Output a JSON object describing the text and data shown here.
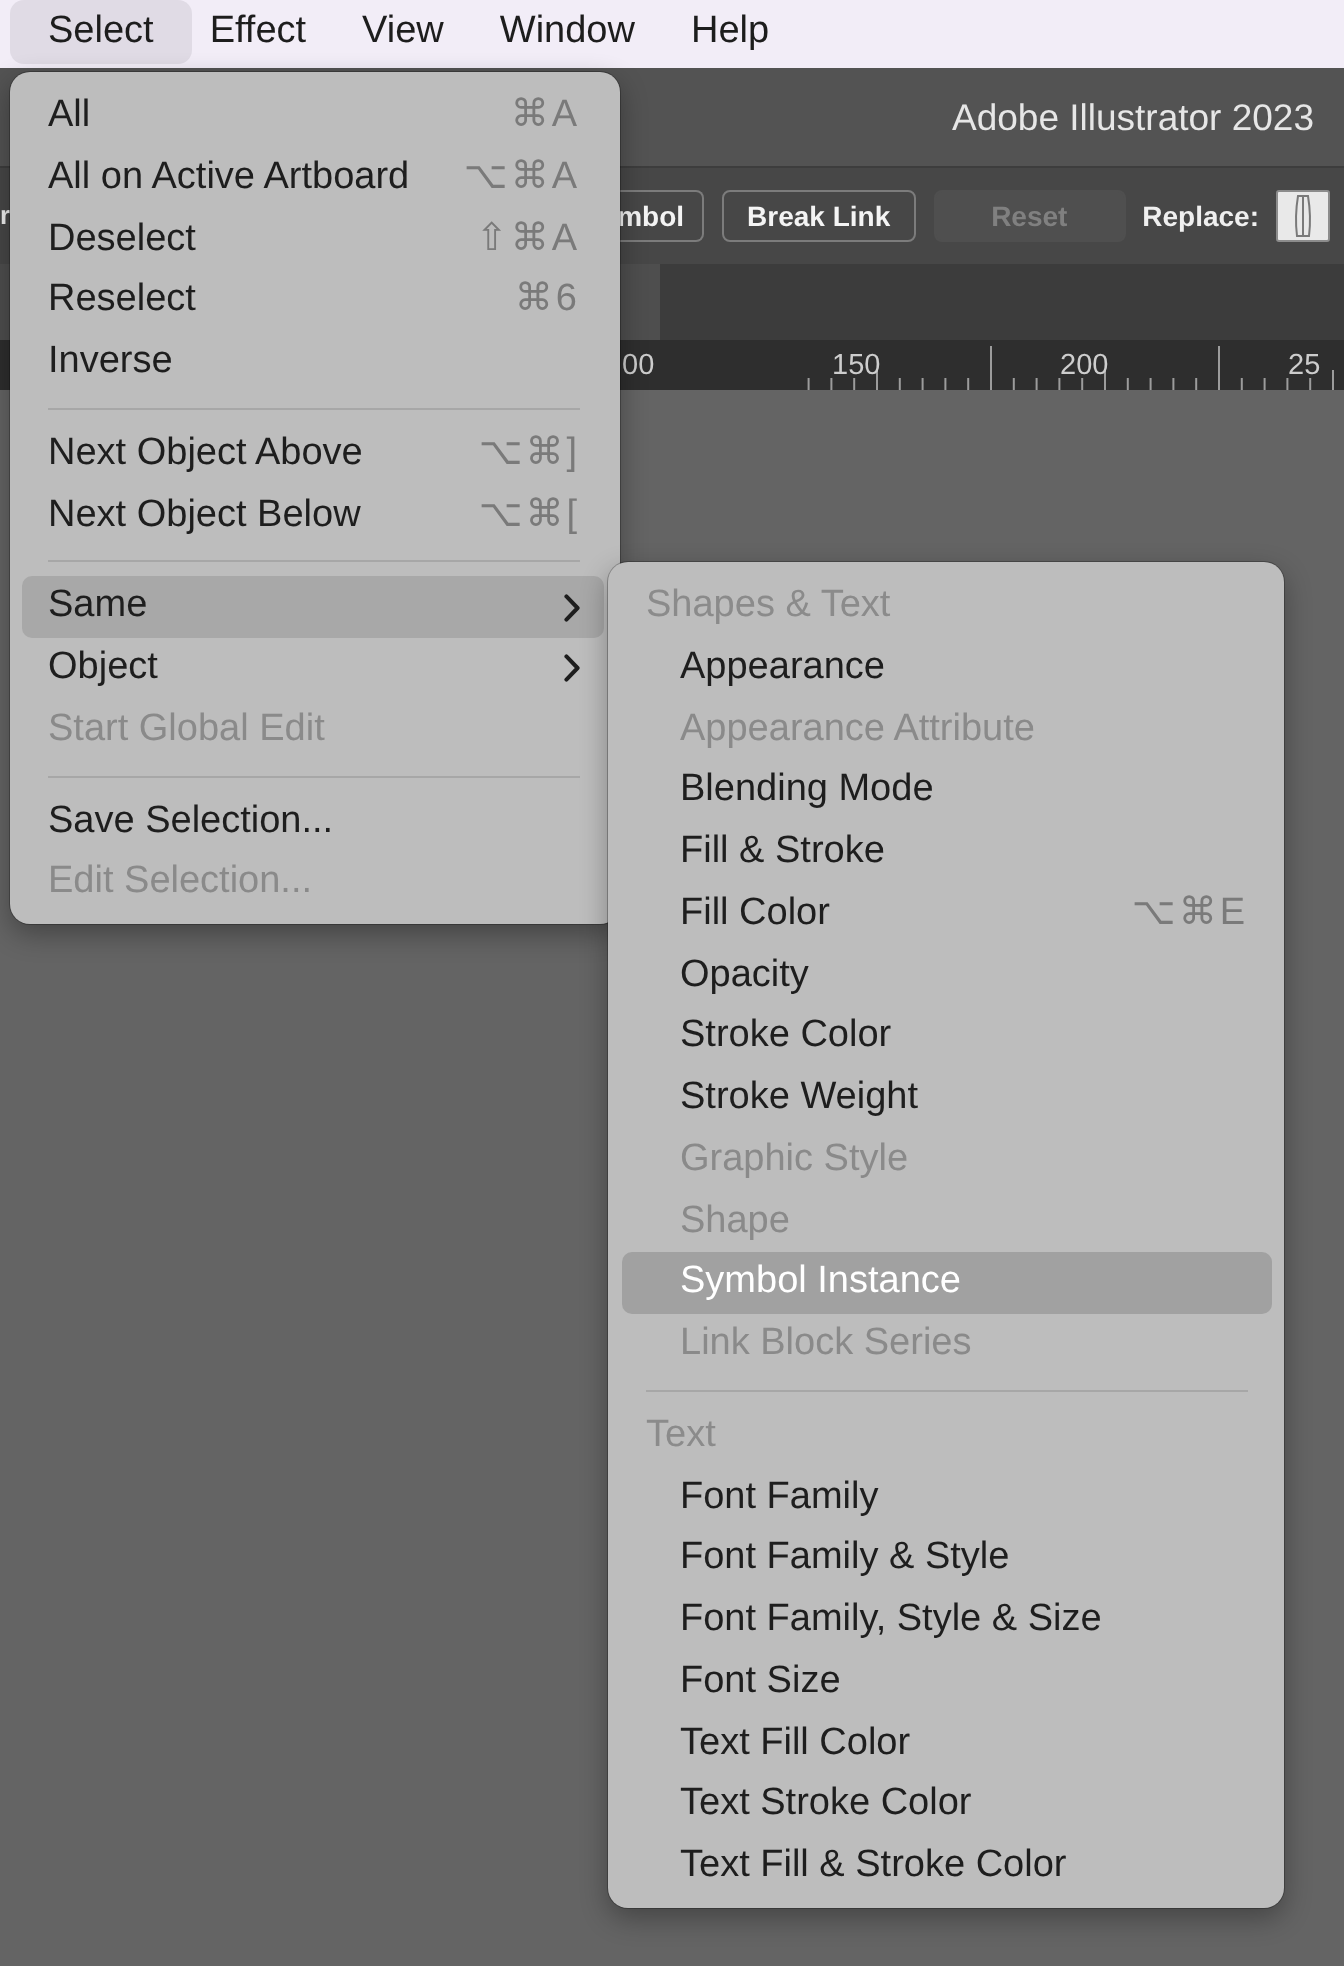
{
  "menu_bar": {
    "items": [
      {
        "label": "Select",
        "selected": true
      },
      {
        "label": "Effect",
        "selected": false
      },
      {
        "label": "View",
        "selected": false
      },
      {
        "label": "Window",
        "selected": false
      },
      {
        "label": "Help",
        "selected": false
      }
    ]
  },
  "title_bar": {
    "title": "Adobe Illustrator 2023"
  },
  "control_bar": {
    "left_fragment": "r",
    "buttons": [
      {
        "label": "mbol",
        "disabled": false
      },
      {
        "label": "Break Link",
        "disabled": false
      },
      {
        "label": "Reset",
        "disabled": true
      }
    ],
    "replace_label": "Replace:"
  },
  "ruler": {
    "labels": [
      "00",
      "150",
      "200",
      "25"
    ]
  },
  "select_menu": {
    "items": [
      {
        "kind": "item",
        "label": "All",
        "shortcut": "⌘A",
        "disabled": false,
        "selected": false,
        "submenu": false
      },
      {
        "kind": "item",
        "label": "All on Active Artboard",
        "shortcut": "⌥⌘A",
        "disabled": false,
        "selected": false,
        "submenu": false
      },
      {
        "kind": "item",
        "label": "Deselect",
        "shortcut": "⇧⌘A",
        "disabled": false,
        "selected": false,
        "submenu": false
      },
      {
        "kind": "item",
        "label": "Reselect",
        "shortcut": "⌘6",
        "disabled": false,
        "selected": false,
        "submenu": false
      },
      {
        "kind": "item",
        "label": "Inverse",
        "disabled": false,
        "selected": false,
        "submenu": false
      },
      {
        "kind": "separator"
      },
      {
        "kind": "item",
        "label": "Next Object Above",
        "shortcut": "⌥⌘]",
        "disabled": false,
        "selected": false,
        "submenu": false
      },
      {
        "kind": "item",
        "label": "Next Object Below",
        "shortcut": "⌥⌘[",
        "disabled": false,
        "selected": false,
        "submenu": false
      },
      {
        "kind": "separator"
      },
      {
        "kind": "item",
        "label": "Same",
        "disabled": false,
        "selected": true,
        "submenu": true
      },
      {
        "kind": "item",
        "label": "Object",
        "disabled": false,
        "selected": false,
        "submenu": true
      },
      {
        "kind": "item",
        "label": "Start Global Edit",
        "disabled": true,
        "selected": false,
        "submenu": false
      },
      {
        "kind": "separator"
      },
      {
        "kind": "item",
        "label": "Save Selection...",
        "disabled": false,
        "selected": false,
        "submenu": false
      },
      {
        "kind": "item",
        "label": "Edit Selection...",
        "disabled": true,
        "selected": false,
        "submenu": false
      }
    ]
  },
  "same_submenu": {
    "items": [
      {
        "kind": "header",
        "label": "Shapes & Text"
      },
      {
        "kind": "item",
        "label": "Appearance",
        "disabled": false,
        "selected": false
      },
      {
        "kind": "item",
        "label": "Appearance Attribute",
        "disabled": true,
        "selected": false
      },
      {
        "kind": "item",
        "label": "Blending Mode",
        "disabled": false,
        "selected": false
      },
      {
        "kind": "item",
        "label": "Fill & Stroke",
        "disabled": false,
        "selected": false
      },
      {
        "kind": "item",
        "label": "Fill Color",
        "shortcut": "⌥⌘E",
        "disabled": false,
        "selected": false
      },
      {
        "kind": "item",
        "label": "Opacity",
        "disabled": false,
        "selected": false
      },
      {
        "kind": "item",
        "label": "Stroke Color",
        "disabled": false,
        "selected": false
      },
      {
        "kind": "item",
        "label": "Stroke Weight",
        "disabled": false,
        "selected": false
      },
      {
        "kind": "item",
        "label": "Graphic Style",
        "disabled": true,
        "selected": false
      },
      {
        "kind": "item",
        "label": "Shape",
        "disabled": true,
        "selected": false
      },
      {
        "kind": "item",
        "label": "Symbol Instance",
        "disabled": false,
        "selected": true
      },
      {
        "kind": "item",
        "label": "Link Block Series",
        "disabled": true,
        "selected": false
      },
      {
        "kind": "separator"
      },
      {
        "kind": "header",
        "label": "Text"
      },
      {
        "kind": "item",
        "label": "Font Family",
        "disabled": false,
        "selected": false
      },
      {
        "kind": "item",
        "label": "Font Family & Style",
        "disabled": false,
        "selected": false
      },
      {
        "kind": "item",
        "label": "Font Family, Style & Size",
        "disabled": false,
        "selected": false
      },
      {
        "kind": "item",
        "label": "Font Size",
        "disabled": false,
        "selected": false
      },
      {
        "kind": "item",
        "label": "Text Fill Color",
        "disabled": false,
        "selected": false
      },
      {
        "kind": "item",
        "label": "Text Stroke Color",
        "disabled": false,
        "selected": false
      },
      {
        "kind": "item",
        "label": "Text Fill & Stroke Color",
        "disabled": false,
        "selected": false
      }
    ]
  }
}
